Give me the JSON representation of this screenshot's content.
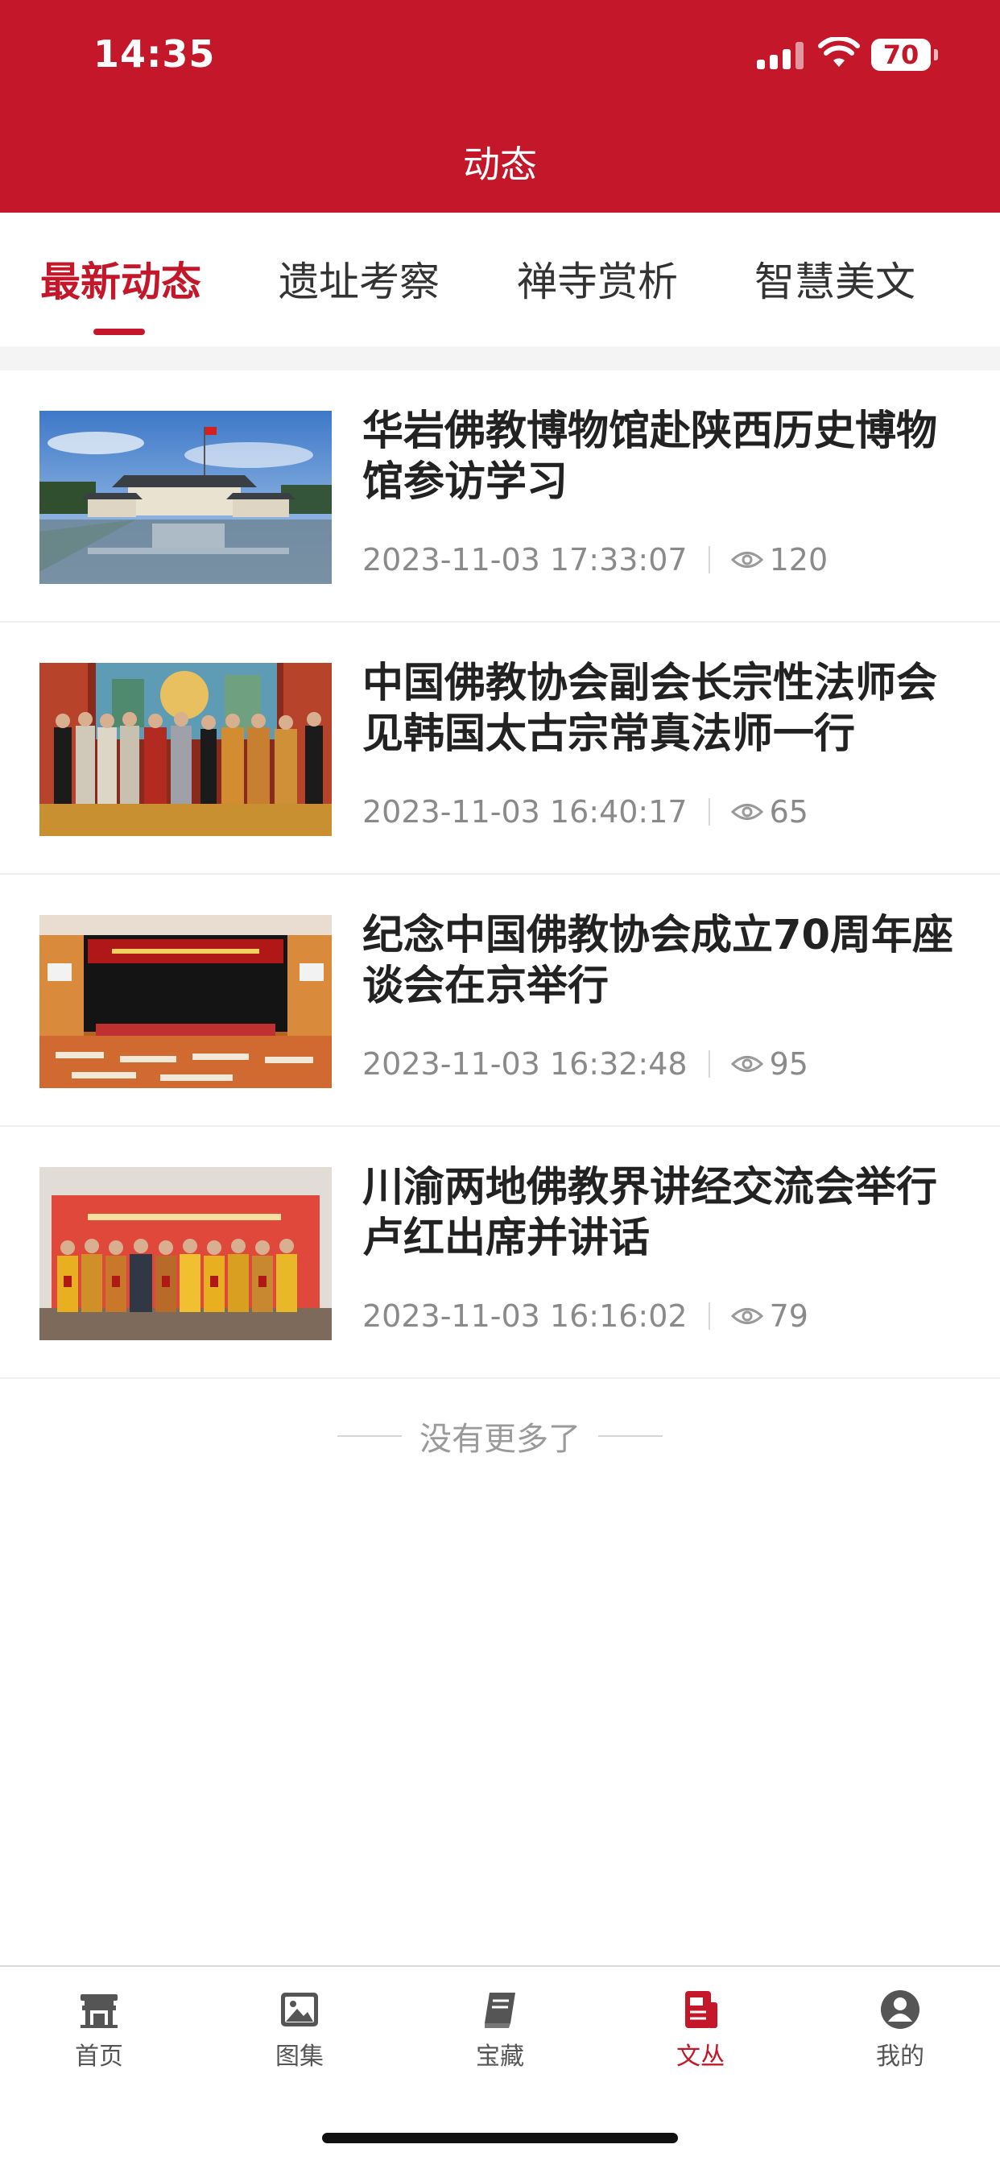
{
  "status_bar": {
    "time": "14:35",
    "battery": "70"
  },
  "header": {
    "title": "动态"
  },
  "tabs": [
    {
      "label": "最新动态",
      "active": true
    },
    {
      "label": "遗址考察",
      "active": false
    },
    {
      "label": "禅寺赏析",
      "active": false
    },
    {
      "label": "智慧美文",
      "active": false
    }
  ],
  "articles": [
    {
      "title": "华岩佛教博物馆赴陕西历史博物馆参访学习",
      "date": "2023-11-03 17:33:07",
      "views": "120",
      "image": "museum-photo"
    },
    {
      "title": "中国佛教协会副会长宗性法师会见韩国太古宗常真法师一行",
      "date": "2023-11-03 16:40:17",
      "views": "65",
      "image": "meeting-group-photo"
    },
    {
      "title": "纪念中国佛教协会成立70周年座谈会在京举行",
      "date": "2023-11-03 16:32:48",
      "views": "95",
      "image": "conference-hall-photo"
    },
    {
      "title": "川渝两地佛教界讲经交流会举行卢红出席并讲话",
      "date": "2023-11-03 16:16:02",
      "views": "79",
      "image": "monks-group-photo"
    }
  ],
  "footer_text": "没有更多了",
  "tabbar": [
    {
      "label": "首页",
      "icon": "temple-icon",
      "active": false
    },
    {
      "label": "图集",
      "icon": "image-icon",
      "active": false
    },
    {
      "label": "宝藏",
      "icon": "book-icon",
      "active": false
    },
    {
      "label": "文丛",
      "icon": "document-icon",
      "active": true
    },
    {
      "label": "我的",
      "icon": "user-icon",
      "active": false
    }
  ],
  "colors": {
    "brand": "#c4172a",
    "text": "#222222",
    "muted": "#8a8a8a"
  }
}
